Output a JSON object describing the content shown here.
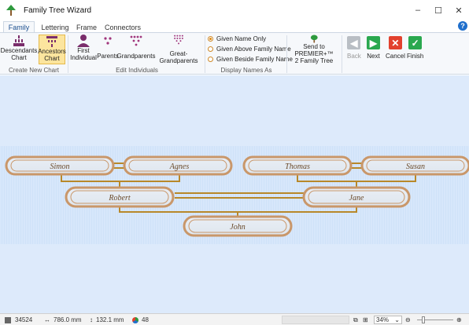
{
  "window": {
    "title": "Family Tree Wizard",
    "controls": [
      "–",
      "☐",
      "✕"
    ]
  },
  "tabs": [
    {
      "label": "Family",
      "active": true
    },
    {
      "label": "Lettering",
      "active": false
    },
    {
      "label": "Frame",
      "active": false
    },
    {
      "label": "Connectors",
      "active": false
    }
  ],
  "help_label": "?",
  "ribbon": {
    "create_new_chart": {
      "group_label": "Create New Chart",
      "descendants": "Descendants\nChart",
      "ancestors": "Ancestors\nChart"
    },
    "edit_individuals": {
      "group_label": "Edit Individuals",
      "first_individual": "First\nIndividual",
      "parents": "Parents",
      "grandparents": "Grandparents",
      "great_grandparents": "Great-Grandparents"
    },
    "display_names": {
      "group_label": "Display Names As",
      "options": [
        {
          "label": "Given Name Only",
          "selected": true
        },
        {
          "label": "Given Above Family Name",
          "selected": false
        },
        {
          "label": "Given Beside Family Name",
          "selected": false
        }
      ]
    },
    "send": "Send to PREMIER+™\n2 Family Tree",
    "wizard": {
      "back": "Back",
      "next": "Next",
      "cancel": "Cancel",
      "finish": "Finish"
    }
  },
  "tree": {
    "great_grandparents_left": [
      "Simon",
      "Agnes"
    ],
    "great_grandparents_right": [
      "Thomas",
      "Susan"
    ],
    "parents": [
      "Robert",
      "Jane"
    ],
    "child": "John"
  },
  "status": {
    "stitches": "34524",
    "width": "786.0 mm",
    "height": "132.1 mm",
    "colors": "48",
    "zoom": "34%"
  },
  "colors": {
    "accent": "#1f6fcc",
    "frame": "#c9976a",
    "connector": "#b8882a",
    "canvas": "#ddeafb"
  }
}
